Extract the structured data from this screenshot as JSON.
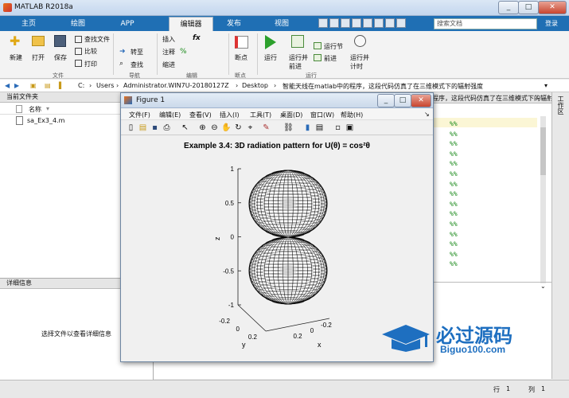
{
  "app": {
    "title": "MATLAB R2018a"
  },
  "tabs": [
    "主页",
    "绘图",
    "APP",
    "编辑器",
    "发布",
    "视图"
  ],
  "active_tab": "编辑器",
  "search": {
    "placeholder": "搜索文档"
  },
  "login": "登录",
  "toolstrip": {
    "file": {
      "new": "新建",
      "open": "打开",
      "save": "保存",
      "find_files": "查找文件",
      "compare": "比较",
      "print": "打印",
      "group": "文件"
    },
    "nav": {
      "goto": "转至",
      "find": "查找",
      "group": "导航"
    },
    "edit": {
      "insert": "插入",
      "comment": "注释",
      "indent": "缩进",
      "group": "编辑"
    },
    "breakpoint": {
      "label": "断点",
      "group": "断点"
    },
    "run": {
      "run": "运行",
      "run_advance": "运行并前进",
      "run_section": "运行节",
      "advance": "前进",
      "run_time": "运行并计时",
      "group": "运行"
    }
  },
  "address": {
    "drive": "C:",
    "p1": "Users",
    "p2": "Administrator.WIN7U-20180127Z",
    "p3": "Desktop",
    "p4": "智能天线在matlab中的程序，这段代码仿真了在三维模式下的辐射强度"
  },
  "current_folder": {
    "title": "当前文件夹",
    "col_name": "名称",
    "files": [
      "sa_Ex3_4.m"
    ]
  },
  "details": {
    "title": "详细信息",
    "hint": "选择文件以查看详细信息"
  },
  "editor": {
    "tab_path": "程序，这段代码仿真了在三维模式下的辐射强度",
    "marks": [
      "%%",
      "%%",
      "%%",
      "%%",
      "%%",
      "%%",
      "%%",
      "%%",
      "%%",
      "%%",
      "%%",
      "%%",
      "%%",
      "%%",
      "%%"
    ]
  },
  "workspace_label": "工作区",
  "status": {
    "row_label": "行",
    "row": "1",
    "col_label": "列",
    "col": "1"
  },
  "figure": {
    "title": "Figure 1",
    "menu": [
      "文件(F)",
      "编辑(E)",
      "查看(V)",
      "插入(I)",
      "工具(T)",
      "桌面(D)",
      "窗口(W)",
      "帮助(H)"
    ],
    "plot_title": "Example 3.4: 3D radiation pattern for U(θ) = cos²θ",
    "zlabel": "z",
    "ylabel": "y",
    "xlabel": "x",
    "z_ticks": [
      "1",
      "0.5",
      "0",
      "-0.5",
      "-1"
    ],
    "y_ticks": [
      "-0.2",
      "0",
      "0.2"
    ],
    "x_ticks": [
      "0.2",
      "0",
      "-0.2"
    ]
  },
  "watermark": {
    "cn": "必过源码",
    "en": "Biguo100.com"
  },
  "colors": {
    "ribbon_blue": "#1f6fb4",
    "code_green": "#1a8a1a",
    "watermark_blue": "#1e6fc0"
  }
}
